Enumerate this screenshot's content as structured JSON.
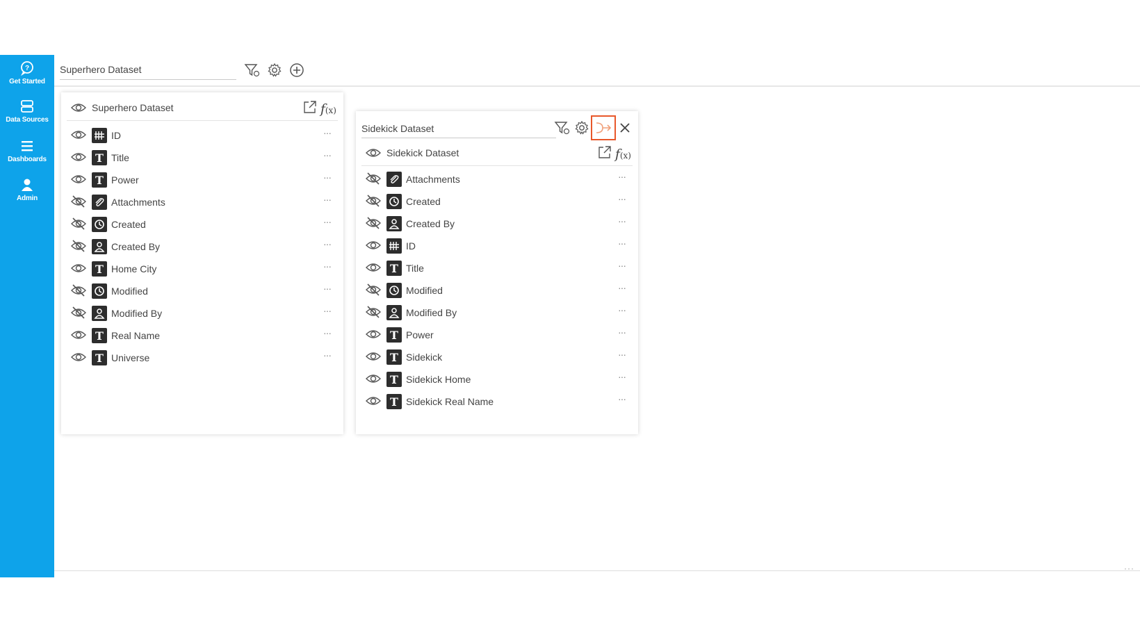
{
  "sidebar": {
    "items": [
      {
        "label": "Get Started",
        "icon": "chat-icon"
      },
      {
        "label": "Data Sources",
        "icon": "database-icon"
      },
      {
        "label": "Dashboards",
        "icon": "menu-icon"
      },
      {
        "label": "Admin",
        "icon": "admin-icon"
      }
    ]
  },
  "topbar": {
    "dataset_value": "Superhero Dataset",
    "icons": [
      "filter-icon",
      "gear-icon",
      "add-circle-icon"
    ]
  },
  "panel1": {
    "title": "Superhero Dataset",
    "fields": [
      {
        "name": "ID",
        "type": "number",
        "visible": true
      },
      {
        "name": "Title",
        "type": "text",
        "visible": true
      },
      {
        "name": "Power",
        "type": "text",
        "visible": true
      },
      {
        "name": "Attachments",
        "type": "attachment",
        "visible": false
      },
      {
        "name": "Created",
        "type": "datetime",
        "visible": false
      },
      {
        "name": "Created By",
        "type": "user",
        "visible": false
      },
      {
        "name": "Home City",
        "type": "text",
        "visible": true
      },
      {
        "name": "Modified",
        "type": "datetime",
        "visible": false
      },
      {
        "name": "Modified By",
        "type": "user",
        "visible": false
      },
      {
        "name": "Real Name",
        "type": "text",
        "visible": true
      },
      {
        "name": "Universe",
        "type": "text",
        "visible": true
      }
    ]
  },
  "panel2": {
    "dataset_value": "Sidekick Dataset",
    "title": "Sidekick Dataset",
    "fields": [
      {
        "name": "Attachments",
        "type": "attachment",
        "visible": false
      },
      {
        "name": "Created",
        "type": "datetime",
        "visible": false
      },
      {
        "name": "Created By",
        "type": "user",
        "visible": false
      },
      {
        "name": "ID",
        "type": "number",
        "visible": true
      },
      {
        "name": "Title",
        "type": "text",
        "visible": true
      },
      {
        "name": "Modified",
        "type": "datetime",
        "visible": false
      },
      {
        "name": "Modified By",
        "type": "user",
        "visible": false
      },
      {
        "name": "Power",
        "type": "text",
        "visible": true
      },
      {
        "name": "Sidekick",
        "type": "text",
        "visible": true
      },
      {
        "name": "Sidekick Home",
        "type": "text",
        "visible": true
      },
      {
        "name": "Sidekick Real Name",
        "type": "text",
        "visible": true
      }
    ]
  },
  "row_more": "···",
  "fx": {
    "f": "f",
    "x": "(x)"
  },
  "colors": {
    "sidebar": "#0ea3ea",
    "highlight": "#e8572a"
  }
}
